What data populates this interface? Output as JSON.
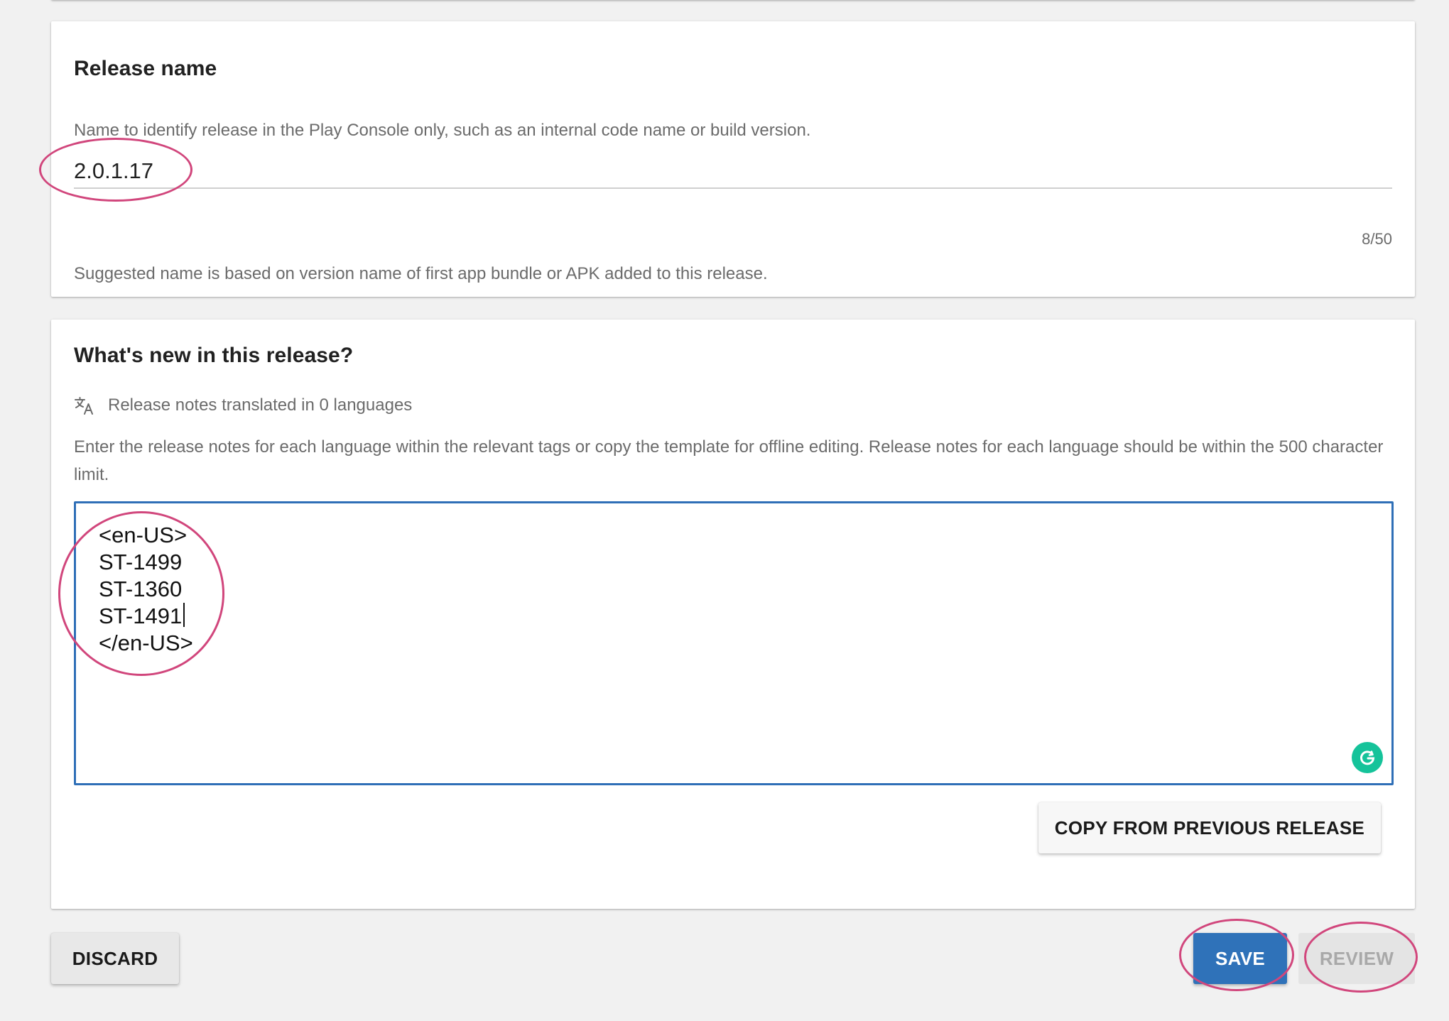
{
  "release_name": {
    "title": "Release name",
    "description": "Name to identify release in the Play Console only, such as an internal code name or build version.",
    "value": "2.0.1.17",
    "counter": "8/50",
    "hint": "Suggested name is based on version name of first app bundle or APK added to this release."
  },
  "whats_new": {
    "title": "What's new in this release?",
    "translated_label": "Release notes translated in 0 languages",
    "translate_icon": "translate-icon",
    "instructions": "Enter the release notes for each language within the relevant tags or copy the template for offline editing. Release notes for each language should be within the 500 character limit.",
    "notes_lines": [
      "<en-US>",
      "ST-1499",
      "ST-1360",
      "ST-1491",
      "</en-US>"
    ],
    "grammarly_icon": "grammarly-icon",
    "copy_button": "COPY FROM PREVIOUS RELEASE"
  },
  "footer": {
    "discard": "DISCARD",
    "save": "SAVE",
    "review": "REVIEW"
  },
  "colors": {
    "accent": "#2f72b9",
    "annotation": "#d1467c",
    "grammarly": "#15c39a"
  }
}
